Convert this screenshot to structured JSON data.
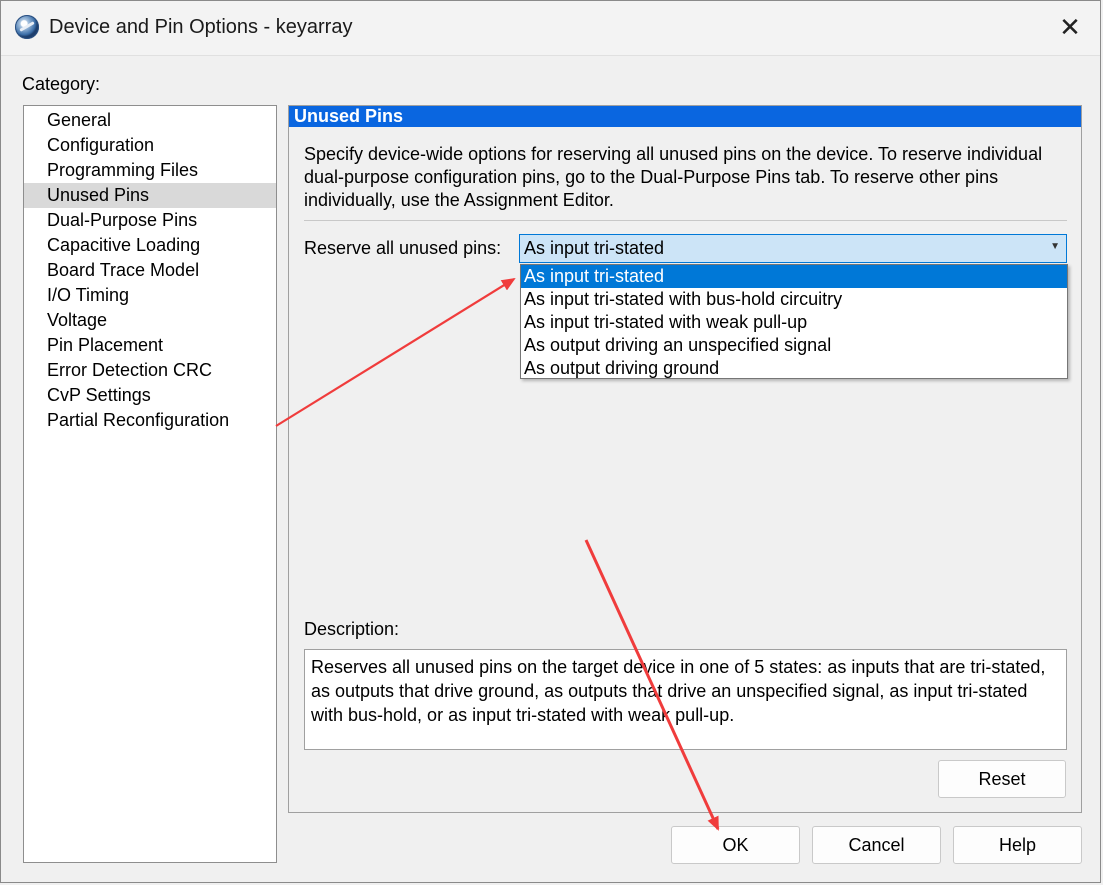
{
  "window": {
    "title": "Device and Pin Options - keyarray",
    "close_glyph": "✕"
  },
  "category": {
    "label": "Category:",
    "items": [
      {
        "label": "General"
      },
      {
        "label": "Configuration"
      },
      {
        "label": "Programming Files"
      },
      {
        "label": "Unused Pins",
        "selected": true
      },
      {
        "label": "Dual-Purpose Pins"
      },
      {
        "label": "Capacitive Loading"
      },
      {
        "label": "Board Trace Model"
      },
      {
        "label": "I/O Timing"
      },
      {
        "label": "Voltage"
      },
      {
        "label": "Pin Placement"
      },
      {
        "label": "Error Detection CRC"
      },
      {
        "label": "CvP Settings"
      },
      {
        "label": "Partial Reconfiguration"
      }
    ]
  },
  "panel": {
    "header": "Unused Pins",
    "intro": "Specify device-wide options for reserving all unused pins on the device. To reserve individual dual-purpose configuration pins, go to the Dual-Purpose Pins tab. To reserve other pins individually, use the Assignment Editor.",
    "reserve_label": "Reserve all unused pins:",
    "combo_value": "As input tri-stated",
    "options": [
      {
        "label": "As input tri-stated",
        "selected": true
      },
      {
        "label": "As input tri-stated with bus-hold circuitry"
      },
      {
        "label": "As input tri-stated with weak pull-up"
      },
      {
        "label": "As output driving an unspecified signal"
      },
      {
        "label": "As output driving ground"
      }
    ],
    "description_label": "Description:",
    "description": "Reserves all unused pins on the target device in one of 5 states: as inputs that are tri-stated, as outputs that drive ground, as outputs that drive an unspecified signal, as input tri-stated with bus-hold, or as input tri-stated with weak pull-up.",
    "reset_label": "Reset"
  },
  "footer": {
    "ok_label": "OK",
    "cancel_label": "Cancel",
    "help_label": "Help"
  },
  "colors": {
    "header_blue": "#0a66e0",
    "selection_blue": "#0078d7",
    "annotation_red": "#f03c3c"
  }
}
